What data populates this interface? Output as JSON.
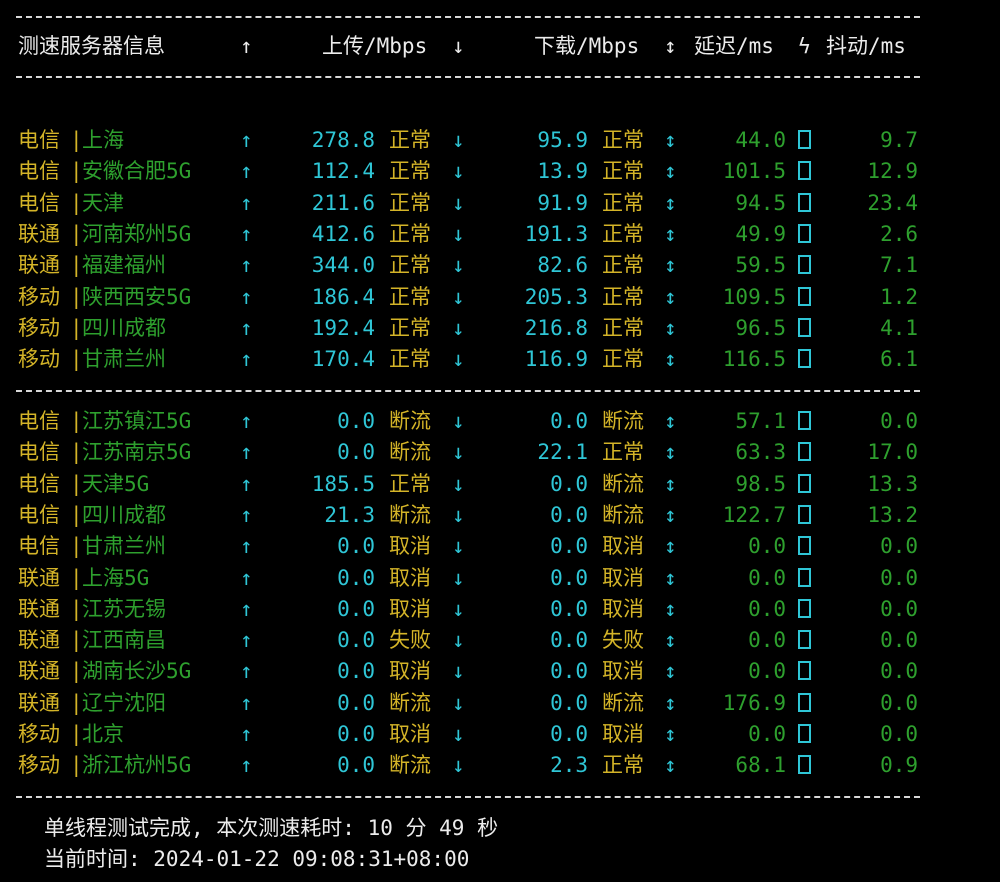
{
  "header": {
    "server_info": "测速服务器信息",
    "up_arrow": "↑",
    "upload": "上传/Mbps",
    "down_arrow": "↓",
    "download": "下载/Mbps",
    "updown_arrow": "↕",
    "latency": "延迟/ms",
    "bolt": "ϟ",
    "jitter": "抖动/ms"
  },
  "symbols": {
    "bar": "|",
    "up": "↑",
    "down": "↓",
    "updown": "↕"
  },
  "colors": {
    "background": "#000000",
    "isp": "#d4b428",
    "city": "#2ea02e",
    "speed": "#2fc6d6",
    "status": "#d4b428",
    "latency": "#2ea02e",
    "text": "#ececec"
  },
  "icons": {
    "header_latency_jitter": "lightning-bolt-icon",
    "row_marker": "missing-glyph-box-icon"
  },
  "group1": [
    {
      "isp": "电信",
      "city": "上海",
      "up": "278.8",
      "up_status": "正常",
      "down": "95.9",
      "down_status": "正常",
      "latency": "44.0",
      "jitter": "9.7"
    },
    {
      "isp": "电信",
      "city": "安徽合肥5G",
      "up": "112.4",
      "up_status": "正常",
      "down": "13.9",
      "down_status": "正常",
      "latency": "101.5",
      "jitter": "12.9"
    },
    {
      "isp": "电信",
      "city": "天津",
      "up": "211.6",
      "up_status": "正常",
      "down": "91.9",
      "down_status": "正常",
      "latency": "94.5",
      "jitter": "23.4"
    },
    {
      "isp": "联通",
      "city": "河南郑州5G",
      "up": "412.6",
      "up_status": "正常",
      "down": "191.3",
      "down_status": "正常",
      "latency": "49.9",
      "jitter": "2.6"
    },
    {
      "isp": "联通",
      "city": "福建福州",
      "up": "344.0",
      "up_status": "正常",
      "down": "82.6",
      "down_status": "正常",
      "latency": "59.5",
      "jitter": "7.1"
    },
    {
      "isp": "移动",
      "city": "陕西西安5G",
      "up": "186.4",
      "up_status": "正常",
      "down": "205.3",
      "down_status": "正常",
      "latency": "109.5",
      "jitter": "1.2"
    },
    {
      "isp": "移动",
      "city": "四川成都",
      "up": "192.4",
      "up_status": "正常",
      "down": "216.8",
      "down_status": "正常",
      "latency": "96.5",
      "jitter": "4.1"
    },
    {
      "isp": "移动",
      "city": "甘肃兰州",
      "up": "170.4",
      "up_status": "正常",
      "down": "116.9",
      "down_status": "正常",
      "latency": "116.5",
      "jitter": "6.1"
    }
  ],
  "group2": [
    {
      "isp": "电信",
      "city": "江苏镇江5G",
      "up": "0.0",
      "up_status": "断流",
      "down": "0.0",
      "down_status": "断流",
      "latency": "57.1",
      "jitter": "0.0"
    },
    {
      "isp": "电信",
      "city": "江苏南京5G",
      "up": "0.0",
      "up_status": "断流",
      "down": "22.1",
      "down_status": "正常",
      "latency": "63.3",
      "jitter": "17.0"
    },
    {
      "isp": "电信",
      "city": "天津5G",
      "up": "185.5",
      "up_status": "正常",
      "down": "0.0",
      "down_status": "断流",
      "latency": "98.5",
      "jitter": "13.3"
    },
    {
      "isp": "电信",
      "city": "四川成都",
      "up": "21.3",
      "up_status": "断流",
      "down": "0.0",
      "down_status": "断流",
      "latency": "122.7",
      "jitter": "13.2"
    },
    {
      "isp": "电信",
      "city": "甘肃兰州",
      "up": "0.0",
      "up_status": "取消",
      "down": "0.0",
      "down_status": "取消",
      "latency": "0.0",
      "jitter": "0.0"
    },
    {
      "isp": "联通",
      "city": "上海5G",
      "up": "0.0",
      "up_status": "取消",
      "down": "0.0",
      "down_status": "取消",
      "latency": "0.0",
      "jitter": "0.0"
    },
    {
      "isp": "联通",
      "city": "江苏无锡",
      "up": "0.0",
      "up_status": "取消",
      "down": "0.0",
      "down_status": "取消",
      "latency": "0.0",
      "jitter": "0.0"
    },
    {
      "isp": "联通",
      "city": "江西南昌",
      "up": "0.0",
      "up_status": "失败",
      "down": "0.0",
      "down_status": "失败",
      "latency": "0.0",
      "jitter": "0.0"
    },
    {
      "isp": "联通",
      "city": "湖南长沙5G",
      "up": "0.0",
      "up_status": "取消",
      "down": "0.0",
      "down_status": "取消",
      "latency": "0.0",
      "jitter": "0.0"
    },
    {
      "isp": "联通",
      "city": "辽宁沈阳",
      "up": "0.0",
      "up_status": "断流",
      "down": "0.0",
      "down_status": "断流",
      "latency": "176.9",
      "jitter": "0.0"
    },
    {
      "isp": "移动",
      "city": "北京",
      "up": "0.0",
      "up_status": "取消",
      "down": "0.0",
      "down_status": "取消",
      "latency": "0.0",
      "jitter": "0.0"
    },
    {
      "isp": "移动",
      "city": "浙江杭州5G",
      "up": "0.0",
      "up_status": "断流",
      "down": "2.3",
      "down_status": "正常",
      "latency": "68.1",
      "jitter": "0.9"
    }
  ],
  "footer": {
    "done": "单线程测试完成, 本次测速耗时: 10 分 49 秒",
    "time": "当前时间: 2024-01-22 09:08:31+08:00"
  }
}
